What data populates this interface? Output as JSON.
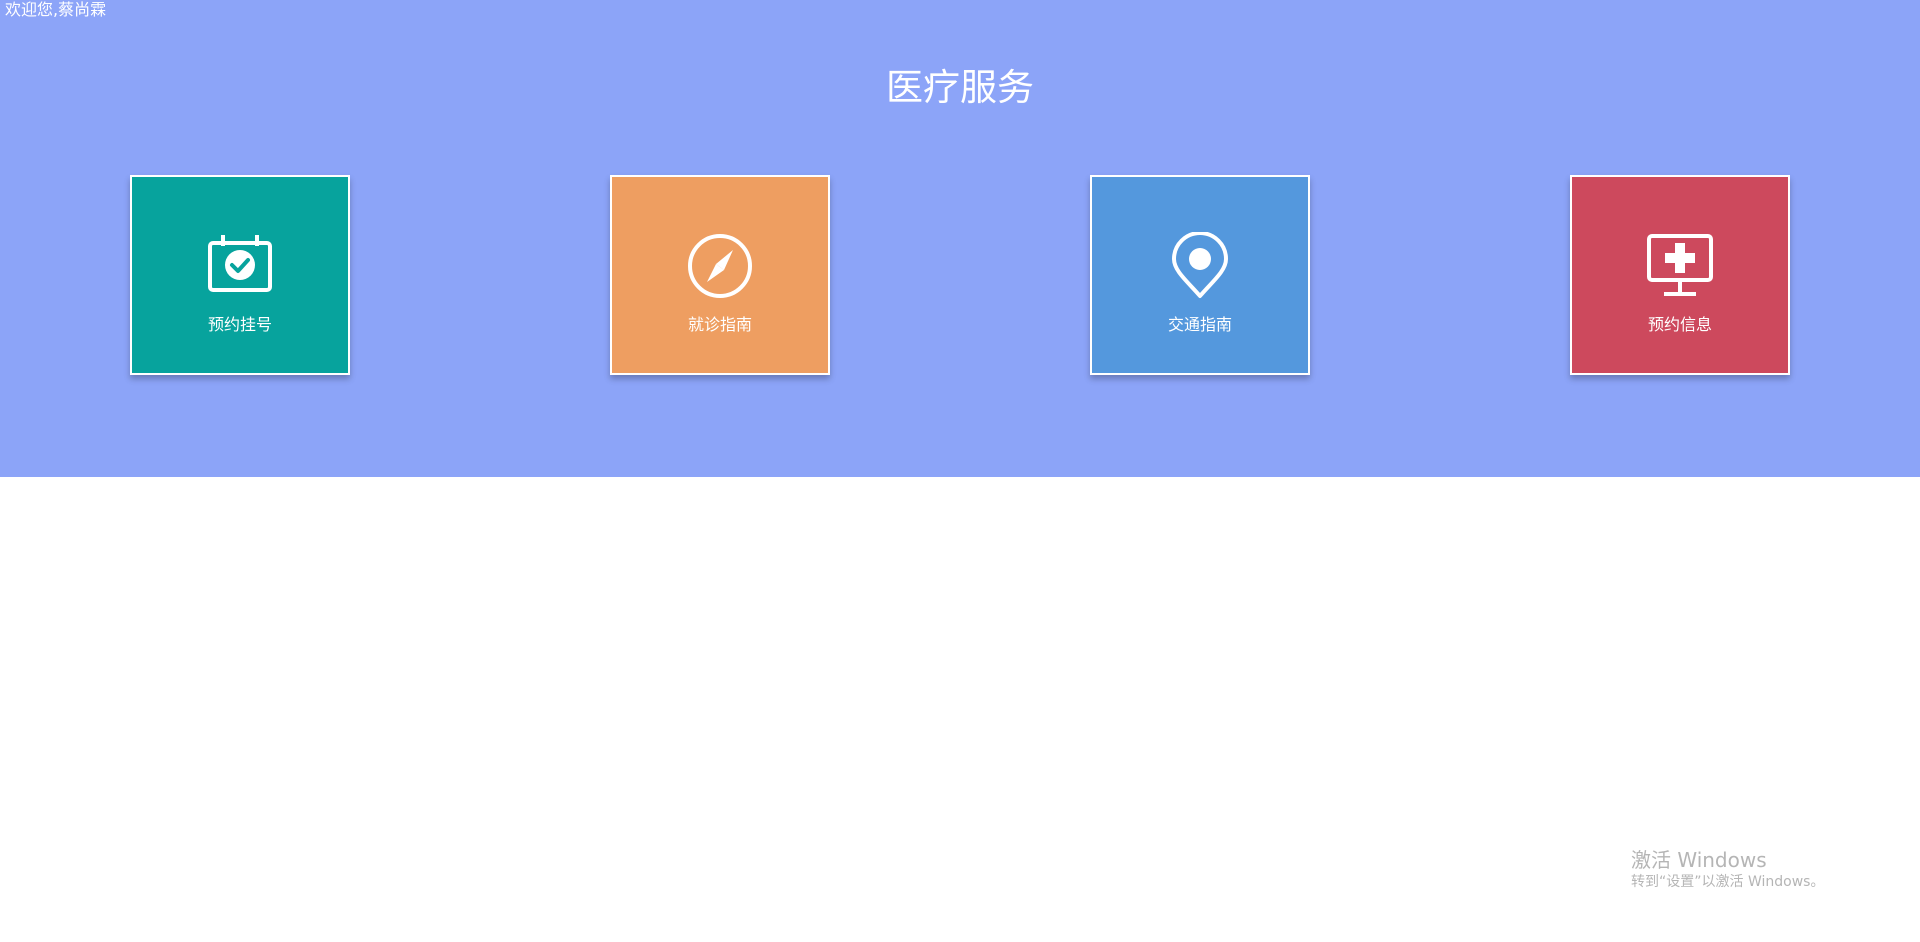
{
  "header": {
    "welcome": "欢迎您,蔡尚霖",
    "title": "医疗服务"
  },
  "banner_color": "#8ca4f8",
  "cards": [
    {
      "label": "预约挂号",
      "icon": "calendar-check-icon",
      "color": "#07a39d"
    },
    {
      "label": "就诊指南",
      "icon": "compass-icon",
      "color": "#ee9e61"
    },
    {
      "label": "交通指南",
      "icon": "map-pin-icon",
      "color": "#5498dd"
    },
    {
      "label": "预约信息",
      "icon": "medical-monitor-icon",
      "color": "#cd495d"
    }
  ],
  "watermark": {
    "title": "激活 Windows",
    "subtitle": "转到“设置”以激活 Windows。"
  }
}
